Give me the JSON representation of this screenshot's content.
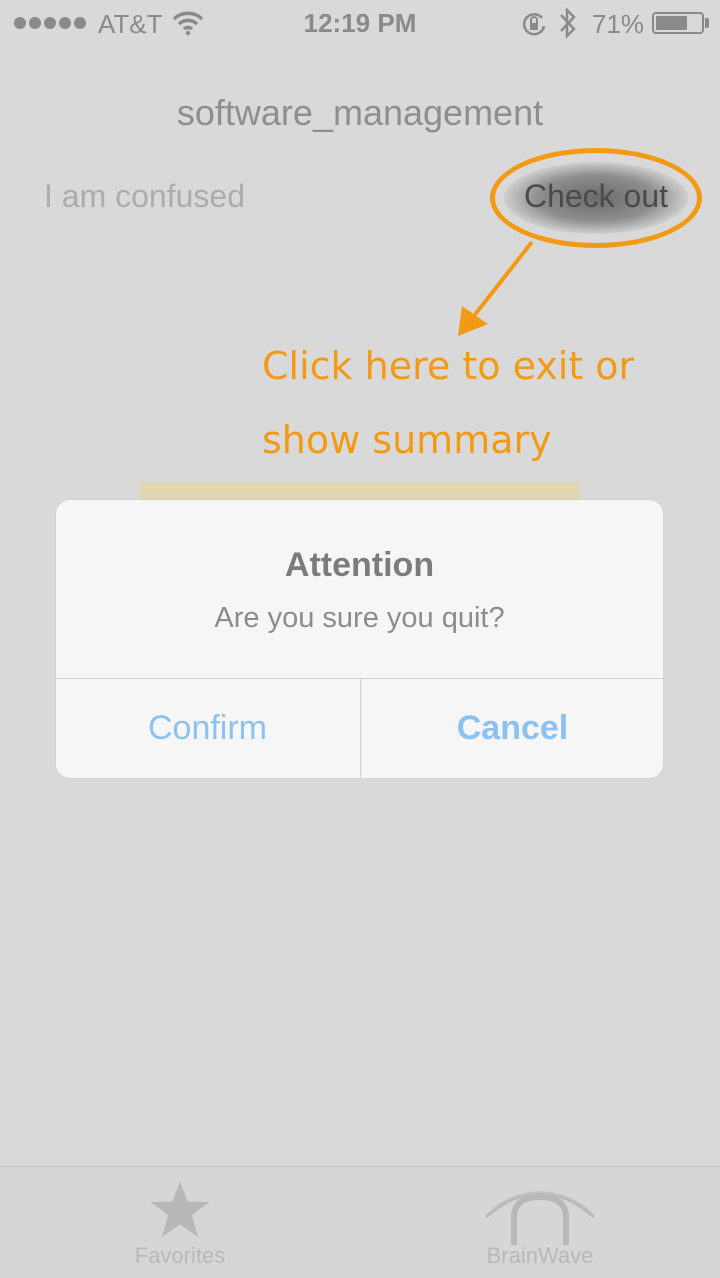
{
  "status_bar": {
    "carrier": "AT&T",
    "time": "12:19 PM",
    "battery_percent": "71%",
    "battery_level": 0.71
  },
  "header": {
    "title": "software_management"
  },
  "nav": {
    "left_label": "I am confused",
    "right_label": "Check out"
  },
  "annotation": {
    "line1": "Click here to exit or",
    "line2": "show summary",
    "color": "#f39a14"
  },
  "alert": {
    "title": "Attention",
    "message": "Are you sure you quit?",
    "confirm_label": "Confirm",
    "cancel_label": "Cancel",
    "button_color": "#8cc2f2"
  },
  "tab_bar": {
    "items": [
      {
        "label": "Favorites",
        "icon": "star-icon"
      },
      {
        "label": "BrainWave",
        "icon": "headset-icon"
      }
    ]
  }
}
